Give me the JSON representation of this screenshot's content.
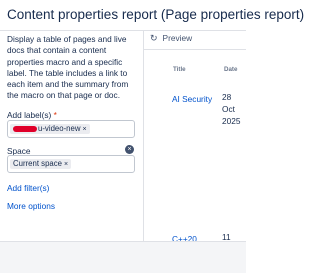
{
  "header": {
    "title": "Content properties report (Page properties report)"
  },
  "form": {
    "description": "Display a table of pages and live docs that contain a content properties macro and a specific label. The table includes a link to each item and the summary from the macro on that page or doc.",
    "labels_field": {
      "label": "Add label(s)",
      "required_mark": "*",
      "chip_text": "u-video-new",
      "chip_remove": "×"
    },
    "space_field": {
      "label": "Space",
      "chip_text": "Current space",
      "chip_remove": "×",
      "clear": "×"
    },
    "add_filters": "Add filter(s)",
    "more_options": "More options"
  },
  "preview": {
    "tab_label": "Preview",
    "refresh_icon": "↻",
    "columns": {
      "title": "Title",
      "date": "Date"
    },
    "rows": [
      {
        "title": "AI Security",
        "date_line1": "28",
        "date_line2": "Oct",
        "date_line3": "2025"
      },
      {
        "title": "C++20",
        "date_line1": "11"
      }
    ]
  }
}
